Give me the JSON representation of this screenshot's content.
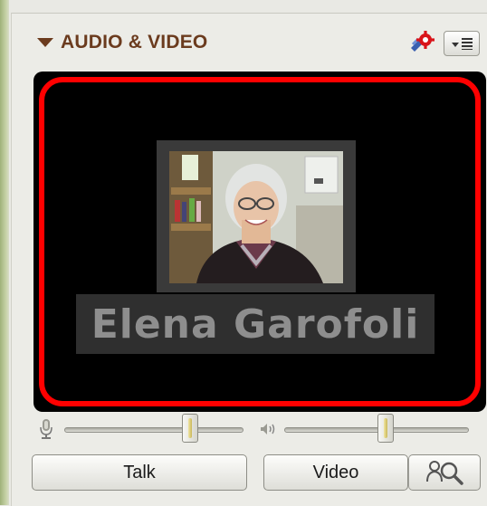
{
  "header": {
    "title": "AUDIO & VIDEO"
  },
  "video": {
    "participant_name": "Elena Garofoli",
    "highlight_color": "#ff0000"
  },
  "controls": {
    "mic_volume": 0.7,
    "speaker_volume": 0.55
  },
  "buttons": {
    "talk_label": "Talk",
    "video_label": "Video"
  },
  "icons": {
    "collapse": "triangle-down-icon",
    "settings": "gear-settings-icon",
    "menu": "panel-menu-icon",
    "mic": "microphone-icon",
    "speaker": "speaker-volume-icon",
    "preview": "video-preview-icon"
  }
}
